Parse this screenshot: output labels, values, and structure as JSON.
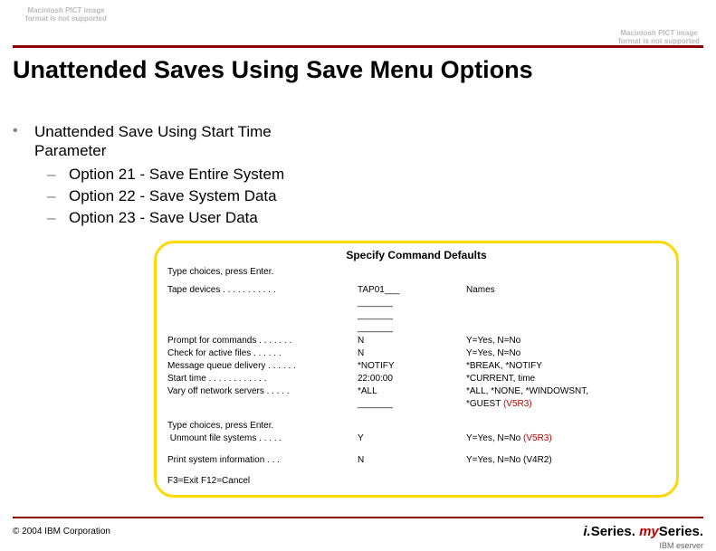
{
  "placeholder_text": "Macintosh PICT\nimage format\nis not supported",
  "title": "Unattended Saves Using Save Menu Options",
  "bullet": {
    "main": "Unattended Save Using Start Time\nParameter",
    "subs": [
      "Option 21 - Save Entire System",
      "Option 22 - Save System Data",
      "Option 23 - Save User Data"
    ]
  },
  "panel": {
    "title": "Specify Command Defaults",
    "instr": "Type choices, press Enter.",
    "block1": {
      "labels": "Tape devices . . . . . . . . . . .",
      "values": "TAP01___\n_______\n_______\n_______",
      "hints": "Names"
    },
    "block2": {
      "labels": "Prompt for commands . . . . . . .\nCheck for active files . . . . . .\nMessage queue delivery . . . . . .\nStart time . . . . . . . . . . . .\nVary off network servers . . . . .",
      "values": "N\nN\n*NOTIFY\n22:00:00\n*ALL\n_______",
      "hints": "Y=Yes, N=No\nY=Yes, N=No\n*BREAK, *NOTIFY\n*CURRENT, time\n*ALL, *NONE, *WINDOWSNT,",
      "hints_extra": "*GUEST ",
      "hints_extra_red": "(V5R3)"
    },
    "block3": {
      "labels": "Type choices, press Enter.\n Unmount file systems . . . . .",
      "values": "\nY",
      "hints_prefix": "\nY=Yes, N=No ",
      "hints_red": "(V5R3)"
    },
    "block4": {
      "labels": "Print system information . . .",
      "values": "N",
      "hints": "Y=Yes, N=No (V4R2)"
    },
    "fkeys": "F3=Exit  F12=Cancel"
  },
  "copyright": "© 2004 IBM Corporation",
  "brand_i": "i.",
  "brand_series1": "Series.",
  "brand_my": " my",
  "brand_series2": "Series.",
  "eserver": "IBM eserver"
}
